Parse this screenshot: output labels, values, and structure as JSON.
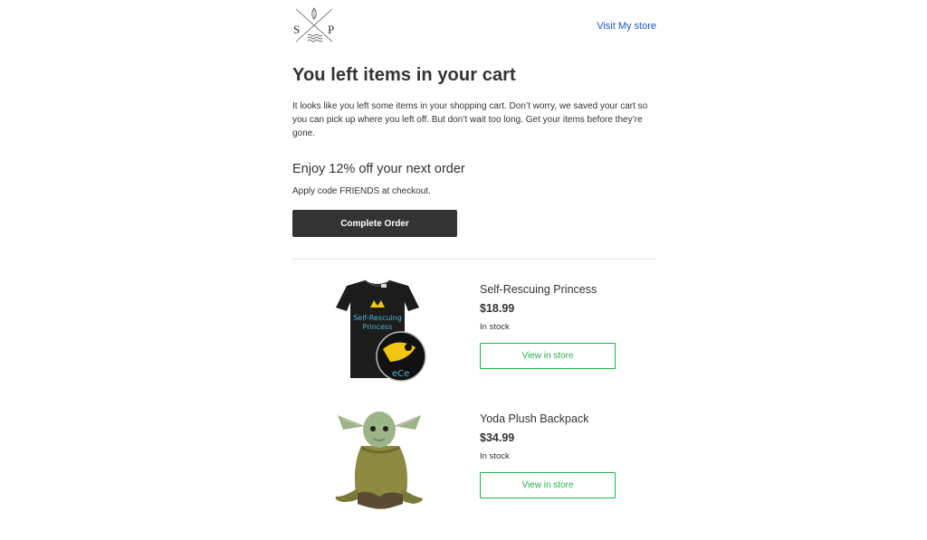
{
  "header": {
    "logo": {
      "letter_left": "S",
      "letter_right": "P",
      "icon": "sp-crossed-logo-icon"
    },
    "visit_store_label": "Visit My store"
  },
  "main": {
    "title": "You left items in your cart",
    "intro": "It looks like you left some items in your shopping cart. Don’t worry, we saved your cart so you can pick up where you left off. But don’t wait too long. Get your items before they’re gone.",
    "promo_heading": "Enjoy 12% off your next order",
    "promo_text": "Apply code FRIENDS at checkout.",
    "cta_label": "Complete Order"
  },
  "products": [
    {
      "name": "Self-Rescuing Princess",
      "price": "$18.99",
      "stock": "In stock",
      "button_label": "View in store",
      "image_icon": "black-tshirt-image"
    },
    {
      "name": "Yoda Plush Backpack",
      "price": "$34.99",
      "stock": "In stock",
      "button_label": "View in store",
      "image_icon": "yoda-plush-backpack-image"
    }
  ],
  "colors": {
    "link": "#1a55c7",
    "button_dark": "#333333",
    "button_outline_green": "#22b34b",
    "divider": "#e2e2e2",
    "text": "#333333"
  }
}
